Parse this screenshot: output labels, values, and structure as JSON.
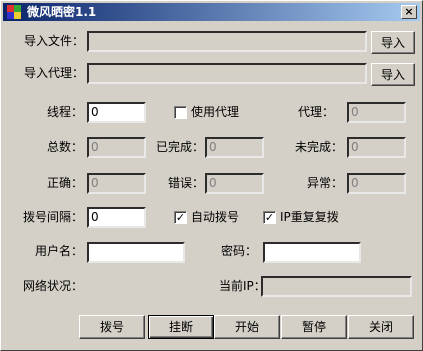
{
  "window": {
    "title": "微风晒密1.1",
    "close_glyph": "×"
  },
  "import": {
    "file_label": "导入文件：",
    "proxy_label": "导入代理：",
    "file_value": "",
    "proxy_value": "",
    "file_button": "导入",
    "proxy_button": "导入"
  },
  "stats": {
    "threads_label": "线程：",
    "threads_value": "0",
    "use_proxy_label": "使用代理",
    "use_proxy_checked": false,
    "proxy_label": "代理：",
    "proxy_value": "0",
    "total_label": "总数：",
    "total_value": "0",
    "done_label": "已完成：",
    "done_value": "0",
    "undone_label": "未完成：",
    "undone_value": "0",
    "correct_label": "正确：",
    "correct_value": "0",
    "error_label": "错误：",
    "error_value": "0",
    "abnormal_label": "异常：",
    "abnormal_value": "0"
  },
  "dial": {
    "interval_label": "拨号间隔：",
    "interval_value": "0",
    "auto_dial_label": "自动拨号",
    "auto_dial_checked": true,
    "ip_repeat_label": "IP重复复拨",
    "ip_repeat_checked": true,
    "username_label": "用户名：",
    "username_value": "",
    "password_label": "密码：",
    "password_value": ""
  },
  "status": {
    "network_label": "网络状况：",
    "current_ip_label": "当前IP：",
    "current_ip_value": ""
  },
  "actions": {
    "dial": "拨号",
    "hangup": "挂断",
    "start": "开始",
    "pause": "暂停",
    "close": "关闭"
  },
  "check_glyph": "✓"
}
